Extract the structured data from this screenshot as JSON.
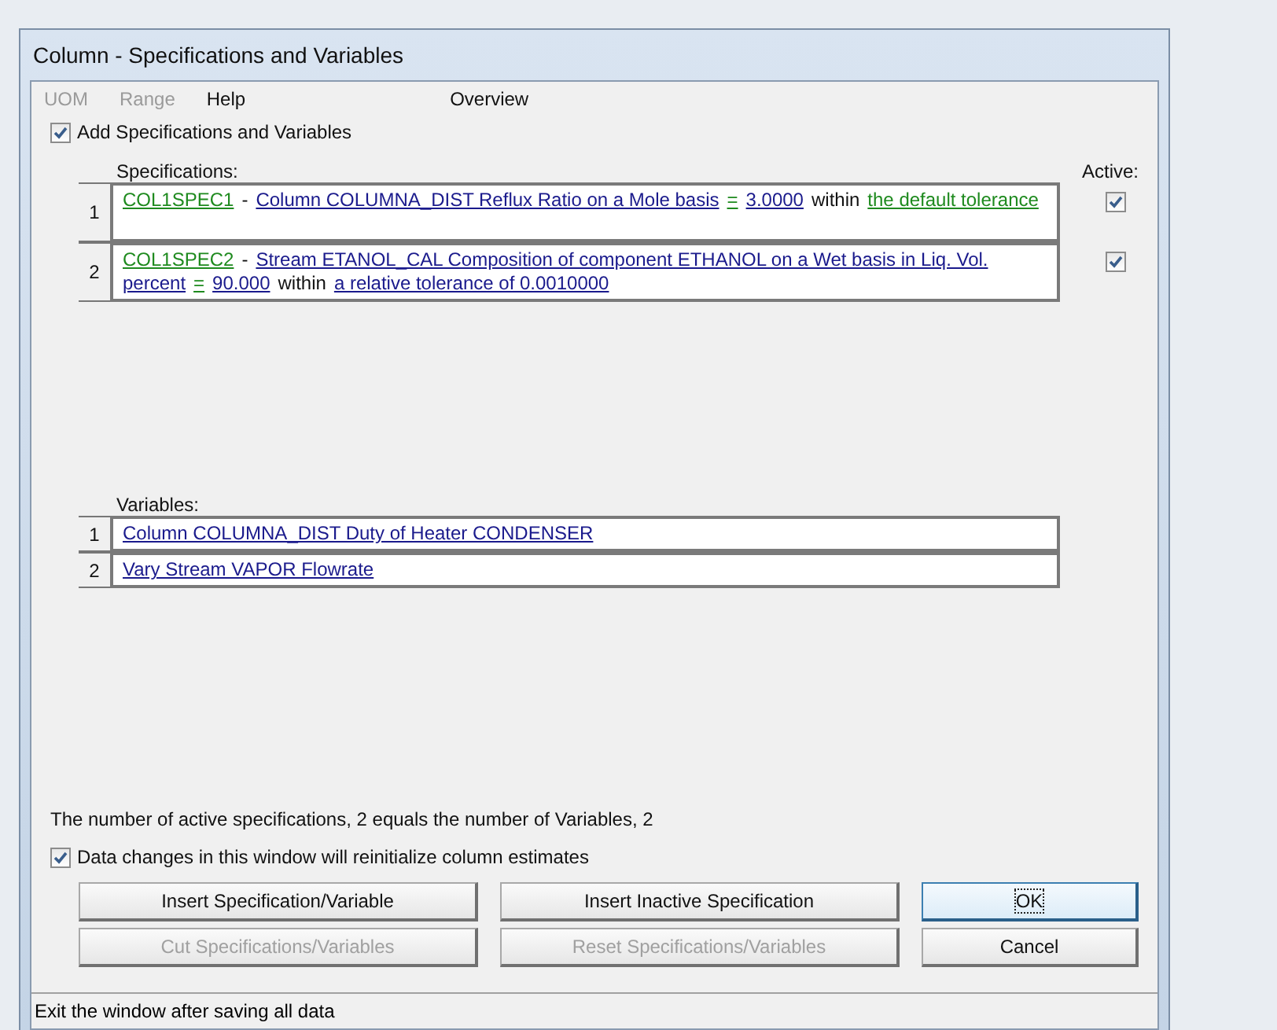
{
  "window": {
    "title": "Column - Specifications and Variables"
  },
  "menu": [
    {
      "label": "UOM",
      "disabled": true
    },
    {
      "label": "Range",
      "disabled": true
    },
    {
      "label": "Help",
      "disabled": false
    },
    {
      "label": "Overview",
      "disabled": false
    }
  ],
  "add_checkbox": {
    "label": "Add Specifications and Variables",
    "checked": true
  },
  "specifications": {
    "label": "Specifications:",
    "active_label": "Active:",
    "rows": [
      {
        "number": "1",
        "active": true,
        "segments": [
          {
            "kind": "tag",
            "text": "COL1SPEC1"
          },
          {
            "kind": "text",
            "text": "-"
          },
          {
            "kind": "link",
            "text": "Column COLUMNA_DIST Reflux Ratio on a Mole basis"
          },
          {
            "kind": "tag",
            "text": "="
          },
          {
            "kind": "link",
            "text": "3.0000"
          },
          {
            "kind": "text",
            "text": "within"
          },
          {
            "kind": "tag",
            "text": "the default tolerance"
          }
        ]
      },
      {
        "number": "2",
        "active": true,
        "segments": [
          {
            "kind": "tag",
            "text": "COL1SPEC2"
          },
          {
            "kind": "text",
            "text": "-"
          },
          {
            "kind": "link",
            "text": "Stream ETANOL_CAL Composition of component ETHANOL on a Wet basis in Liq. Vol. percent"
          },
          {
            "kind": "tag",
            "text": "="
          },
          {
            "kind": "link",
            "text": "90.000"
          },
          {
            "kind": "text",
            "text": "within"
          },
          {
            "kind": "link",
            "text": "a relative tolerance of 0.0010000"
          }
        ]
      }
    ]
  },
  "variables": {
    "label": "Variables:",
    "rows": [
      {
        "number": "1",
        "text": "Column COLUMNA_DIST Duty of Heater CONDENSER"
      },
      {
        "number": "2",
        "text": "Vary Stream VAPOR Flowrate"
      }
    ]
  },
  "summary": "The number of active specifications, 2 equals the number of Variables, 2",
  "reinit_checkbox": {
    "label": "Data changes in this window will reinitialize column estimates",
    "checked": true
  },
  "buttons": [
    {
      "label": "Insert Specification/Variable",
      "disabled": false,
      "focused": false
    },
    {
      "label": "Insert Inactive Specification",
      "disabled": false,
      "focused": false
    },
    {
      "label": "OK",
      "disabled": false,
      "focused": true
    },
    {
      "label": "Cut Specifications/Variables",
      "disabled": true,
      "focused": false
    },
    {
      "label": "Reset Specifications/Variables",
      "disabled": true,
      "focused": false
    },
    {
      "label": "Cancel",
      "disabled": false,
      "focused": false
    }
  ],
  "status_bar": "Exit the window after saving all data"
}
